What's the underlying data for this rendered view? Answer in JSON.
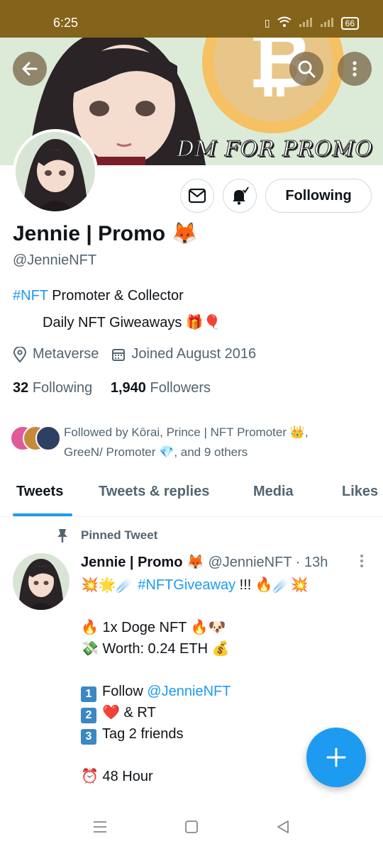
{
  "status_bar": {
    "time": "6:25",
    "battery": "66"
  },
  "banner": {
    "text": "DM FOR PROMO"
  },
  "actions": {
    "following_label": "Following"
  },
  "profile": {
    "name": "Jennie | Promo 🦊",
    "handle": "@JennieNFT",
    "bio_hashtag": "#NFT",
    "bio_line1_rest": " Promoter & Collector",
    "bio_line2": "Daily NFT Giweaways 🎁🎈",
    "location": "Metaverse",
    "joined": "Joined August 2016",
    "following_count": "32",
    "following_label": "Following",
    "followers_count": "1,940",
    "followers_label": "Followers",
    "followed_by_line1": "Followed by Kōrai, Prince | NFT Promoter 👑,",
    "followed_by_line2": "GreeN/ Promoter 💎, and 9 others"
  },
  "tabs": [
    "Tweets",
    "Tweets & replies",
    "Media",
    "Likes"
  ],
  "tweet": {
    "pinned_label": "Pinned Tweet",
    "author_name": "Jennie | Promo 🦊",
    "author_handle": "@JennieNFT",
    "time": "· 13h",
    "line1_prefix": "💥🌟☄️ ",
    "line1_hashtag": "#NFTGiveaway",
    "line1_suffix": " !!! 🔥☄️💥",
    "line2": "🔥 1x Doge NFT 🔥🐶",
    "line3": "💸 Worth: 0.24 ETH 💰",
    "step1_num": "1",
    "step1_text": "Follow ",
    "step1_mention": "@JennieNFT",
    "step2_num": "2",
    "step2_text": "❤️ & RT",
    "step3_num": "3",
    "step3_text": "Tag 2 friends",
    "line_last": "⏰ 48 Hour"
  },
  "colors": {
    "accent": "#1d9bf0",
    "status_bar": "#84631a",
    "banner_bg": "#dcebd8"
  }
}
